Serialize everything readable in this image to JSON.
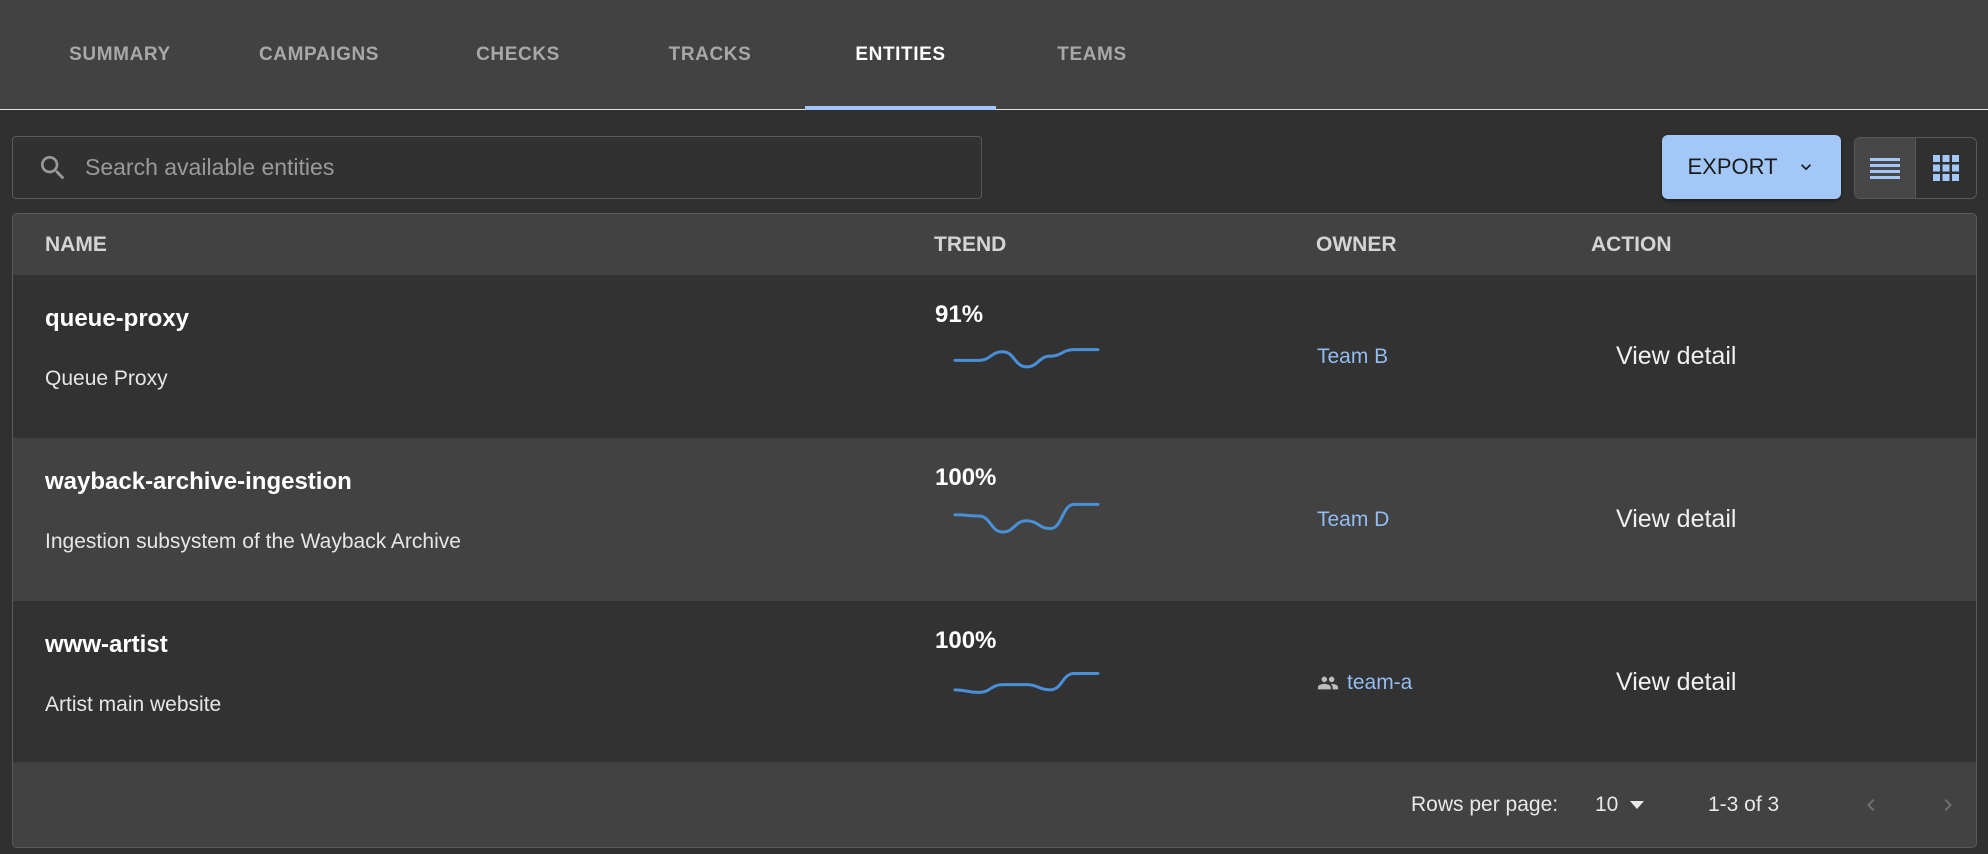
{
  "tabs": [
    {
      "label": "SUMMARY",
      "active": false
    },
    {
      "label": "CAMPAIGNS",
      "active": false
    },
    {
      "label": "CHECKS",
      "active": false
    },
    {
      "label": "TRACKS",
      "active": false
    },
    {
      "label": "ENTITIES",
      "active": true
    },
    {
      "label": "TEAMS",
      "active": false
    }
  ],
  "search": {
    "placeholder": "Search available entities",
    "value": "",
    "icon": "search-icon"
  },
  "toolbar": {
    "export_label": "EXPORT",
    "export_icon": "chevron-down-icon",
    "view_modes": [
      {
        "name": "list-view",
        "icon": "list-icon",
        "active": true
      },
      {
        "name": "grid-view",
        "icon": "grid-icon",
        "active": false
      }
    ]
  },
  "table": {
    "columns": [
      "NAME",
      "TREND",
      "OWNER",
      "ACTION"
    ],
    "rows": [
      {
        "name": "queue-proxy",
        "description": "Queue Proxy",
        "trend_percent": "91%",
        "trend_values": [
          2,
          2,
          4,
          0.5,
          3,
          4.5,
          4.5
        ],
        "owner": "Team B",
        "owner_icon": null,
        "action": "View detail"
      },
      {
        "name": "wayback-archive-ingestion",
        "description": "Ingestion subsystem of the Wayback Archive",
        "trend_percent": "100%",
        "trend_values": [
          4,
          3.7,
          0,
          2.6,
          0.8,
          6.4,
          6.4
        ],
        "owner": "Team D",
        "owner_icon": null,
        "action": "View detail"
      },
      {
        "name": "www-artist",
        "description": "Artist main website",
        "trend_percent": "100%",
        "trend_values": [
          1.2,
          0.6,
          2.4,
          2.4,
          1.2,
          5,
          5
        ],
        "owner": "team-a",
        "owner_icon": "group-icon",
        "action": "View detail"
      }
    ]
  },
  "pagination": {
    "rows_per_page_label": "Rows per page:",
    "rows_per_page": "10",
    "range": "1-3 of 3",
    "prev_icon": "chevron-left-icon",
    "next_icon": "chevron-right-icon"
  },
  "colors": {
    "accent": "#a3c8f8",
    "link": "#93bcf0",
    "sparkline": "#4a90d9",
    "background": "#303030",
    "surface": "#424242"
  }
}
